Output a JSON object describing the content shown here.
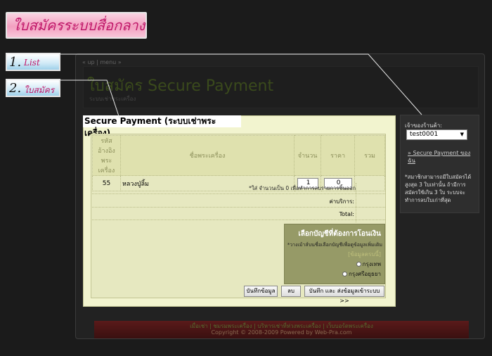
{
  "banner": {
    "title": "ใบสมัครระบบสื่อกลาง"
  },
  "steps": [
    {
      "num": "1.",
      "label": "List"
    },
    {
      "num": "2.",
      "label": "ใบสมัคร"
    }
  ],
  "nav": {
    "breadcrumb": "« up | menu »"
  },
  "header": {
    "title": "ใบสมัคร Secure Payment",
    "subtitle": "ระบบเช่าพระเครื่อง"
  },
  "side": {
    "label": "เจ้าของร้านค้า:",
    "selected_store": "test0001",
    "link": "» Secure Payment ของฉัน",
    "note": "*สมาชิกสามารถมีใบสมัครได้ สูงสุด 3 ใบเท่านั้น ถ้ามีการ สมัครใช้เกิน 3 ใบ ระบบจะ ทำการลบใบเก่าที่สุด"
  },
  "panel": {
    "title": "Secure Payment (ระบบเช่าพระเครื่อง)",
    "columns": [
      "รหัส อ้างอิง พระเครื่อง",
      "ชื่อพระเครื่อง",
      "จำนวน",
      "ราคา",
      "รวม"
    ],
    "row": {
      "code": "55",
      "name": "หลวงปู่ลิ้ม",
      "qty": "1",
      "price": "0",
      "total": ""
    },
    "note": "*ใส่ จำนวนเป็น 0 เพื่อทำการลบรายการชิ้นออก",
    "service_label": "ค่าบริการ:",
    "total_label": "Total:"
  },
  "bank": {
    "title": "เลือกบัญชีที่ต้องการโอนเงิน",
    "desc": "*วางเม้าส์บนชื่อเลือกบัญชีเพื่อดูข้อมูลเพิ่มเติม",
    "missing": "[ข้อมูลครบนี้]",
    "options": [
      "กรุงเทพ",
      "กรุงศรีอยุธยา"
    ]
  },
  "buttons": {
    "save": "บันทึกข้อมูล",
    "delete": "ลบ",
    "submit": "บันทึก และ ส่งข้อมูลเข้าระบบ >>"
  },
  "footer": {
    "links": "เมื่อเช่า  |  ชมรมพระเครื่อง  |  บริหารเช่าที่ห่วงพระเครื่อง  |  เว็บบอร์ดพระเครื่อง",
    "copyright": "Copyright © 2008-2009 Powered by Web-Pra.com"
  },
  "colors": {
    "accent_pink": "#c0186a",
    "panel_bg": "#f2f4cf",
    "bank_bg": "#969a67"
  }
}
